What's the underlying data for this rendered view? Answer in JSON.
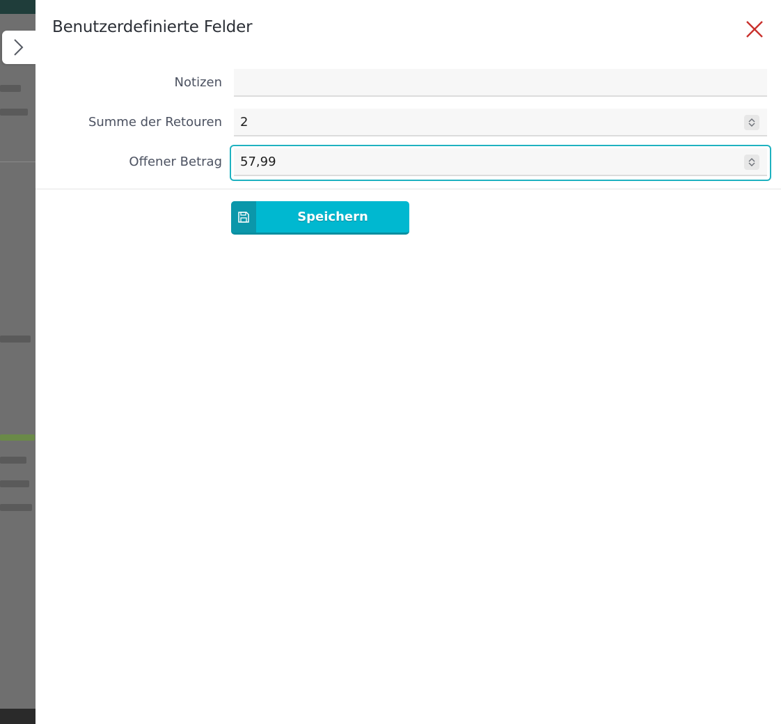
{
  "dialog": {
    "title": "Benutzerdefinierte Felder",
    "close_icon": "close-icon",
    "accent_color": "#1fb2c0",
    "close_color": "#c9302c"
  },
  "fields": [
    {
      "label": "Notizen",
      "value": "",
      "type": "text"
    },
    {
      "label": "Summe der Retouren",
      "value": "2",
      "type": "number"
    },
    {
      "label": "Offener Betrag",
      "value": "57,99",
      "type": "number",
      "focused": true
    }
  ],
  "actions": {
    "save_label": "Speichern",
    "save_icon": "floppy-disk-icon",
    "button_color": "#00b8d0"
  },
  "sidebar": {
    "expand_icon": "chevron-right-icon"
  }
}
